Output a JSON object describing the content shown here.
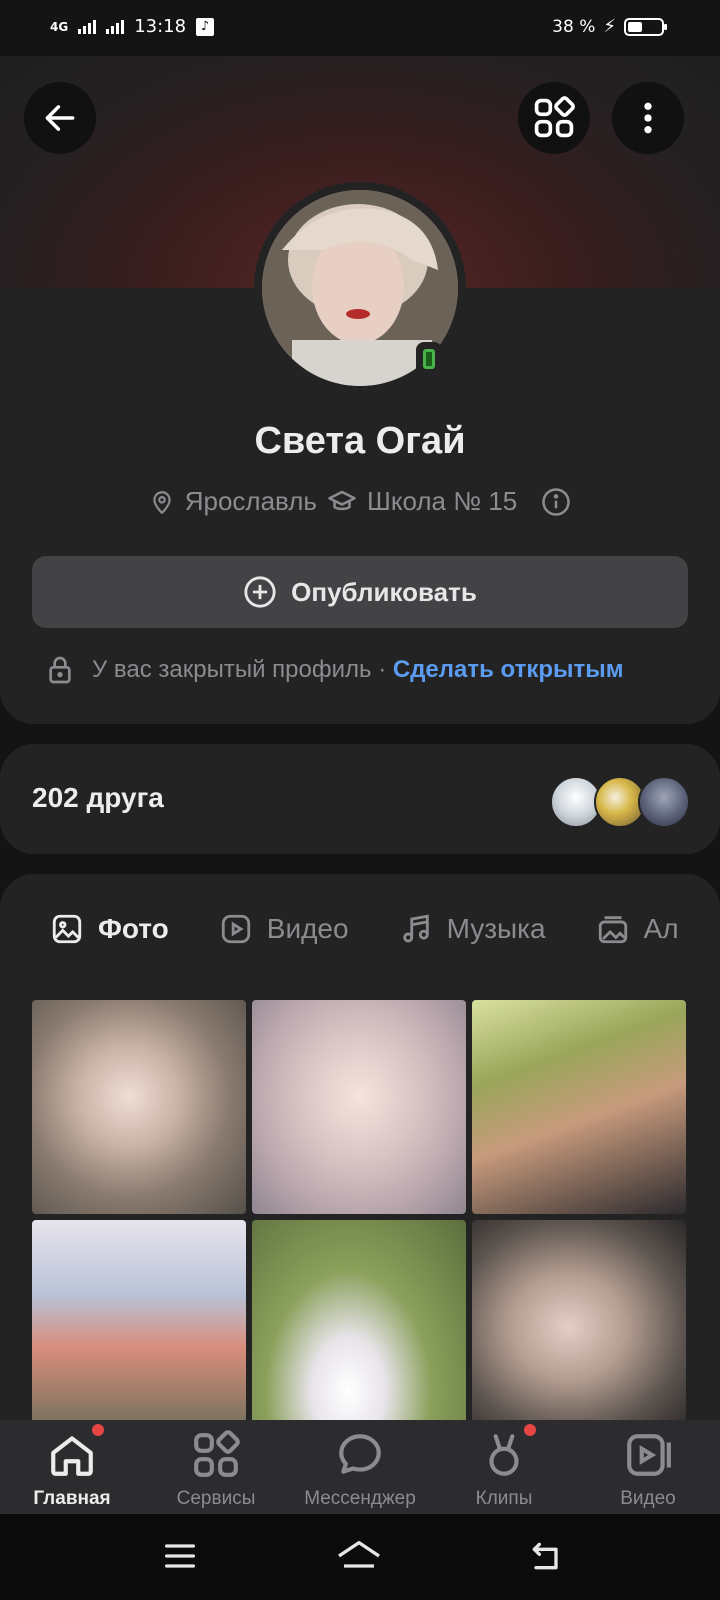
{
  "status_bar": {
    "network": "4G",
    "time": "13:18",
    "battery": "38 %"
  },
  "profile": {
    "name": "Света Огай",
    "city": "Ярославль",
    "school": "Школа № 15",
    "publish_label": "Опубликовать",
    "privacy_text": "У вас закрытый профиль ·",
    "privacy_link": "Сделать открытым"
  },
  "friends": {
    "count_label": "202 друга"
  },
  "media_tabs": [
    {
      "label": "Фото",
      "icon": "photo-icon",
      "active": true
    },
    {
      "label": "Видео",
      "icon": "video-icon",
      "active": false
    },
    {
      "label": "Музыка",
      "icon": "music-icon",
      "active": false
    },
    {
      "label": "Ал",
      "icon": "album-icon",
      "active": false
    }
  ],
  "bottom_nav": [
    {
      "label": "Главная",
      "icon": "home-icon",
      "active": true,
      "badge": true
    },
    {
      "label": "Сервисы",
      "icon": "services-icon",
      "active": false,
      "badge": false
    },
    {
      "label": "Мессенджер",
      "icon": "messenger-icon",
      "active": false,
      "badge": false
    },
    {
      "label": "Клипы",
      "icon": "clips-icon",
      "active": false,
      "badge": true
    },
    {
      "label": "Видео",
      "icon": "video-play-icon",
      "active": false,
      "badge": false
    }
  ],
  "colors": {
    "background": "#141414",
    "card": "#232324",
    "accent_link": "#5b9bf0",
    "online": "#4bb34b",
    "badge": "#e64646"
  }
}
